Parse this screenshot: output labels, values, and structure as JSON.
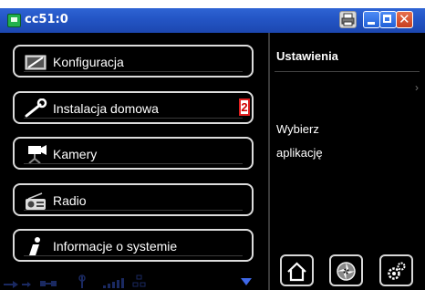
{
  "window": {
    "title": "cc51:0"
  },
  "menu": {
    "items": [
      {
        "label": "Konfiguracja",
        "icon": "config-card-icon"
      },
      {
        "label": "Instalacja domowa",
        "icon": "wrench-icon",
        "badge": "2"
      },
      {
        "label": "Kamery",
        "icon": "camera-icon"
      },
      {
        "label": "Radio",
        "icon": "radio-icon"
      },
      {
        "label": "Informacje o systemie",
        "icon": "info-icon"
      }
    ]
  },
  "panel": {
    "title": "Ustawienia",
    "text_line1": "Wybierz",
    "text_line2": "aplikację"
  },
  "colors": {
    "titlebar": "#2456c6",
    "badge_border": "#e02020",
    "background": "#000000"
  }
}
